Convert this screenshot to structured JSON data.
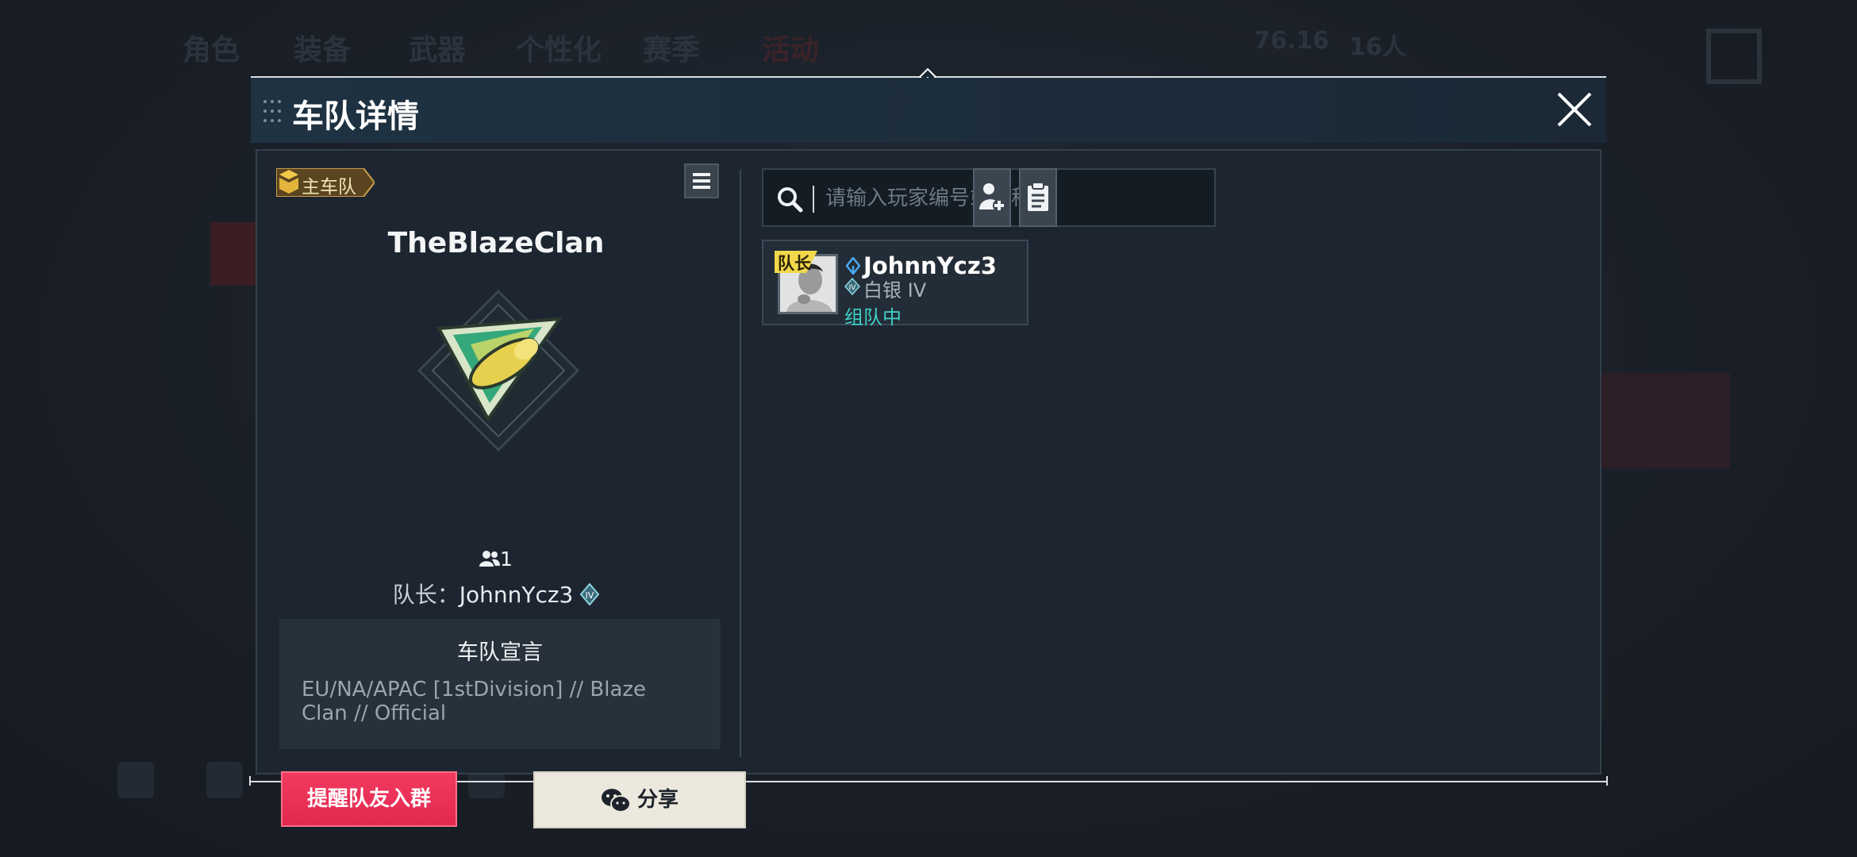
{
  "background": {
    "tabs": [
      "角色",
      "装备",
      "武器",
      "个性化",
      "赛季",
      "活动"
    ],
    "status": [
      "76.16",
      "16人"
    ]
  },
  "dialog": {
    "title": "车队详情",
    "close_label": "X"
  },
  "team": {
    "badge": "主车队",
    "name": "TheBlazeClan",
    "member_count": "1",
    "captain_label": "队长：",
    "captain_name": "JohnnYcz3",
    "declaration_title": "车队宣言",
    "declaration_text": "EU/NA/APAC [1stDivision] // Blaze Clan // Official",
    "remind_button": "提醒队友入群",
    "share_button": "分享"
  },
  "search": {
    "placeholder": "请输入玩家编号或昵称",
    "value": ""
  },
  "members": [
    {
      "leader_tag": "队长",
      "name": "JohnnYcz3",
      "rank": "白银 IV",
      "status": "组队中"
    }
  ],
  "colors": {
    "accent_red": "#ea2e55",
    "status_teal": "#3ed1c8",
    "badge_gold": "#c89b4a",
    "leader_yellow": "#f2d84a"
  },
  "icons": [
    "drag-grip-icon",
    "close-icon",
    "menu-icon",
    "people-icon",
    "rank-iv-icon",
    "search-icon",
    "add-friend-icon",
    "clipboard-icon",
    "wechat-icon",
    "diamond-icon"
  ]
}
